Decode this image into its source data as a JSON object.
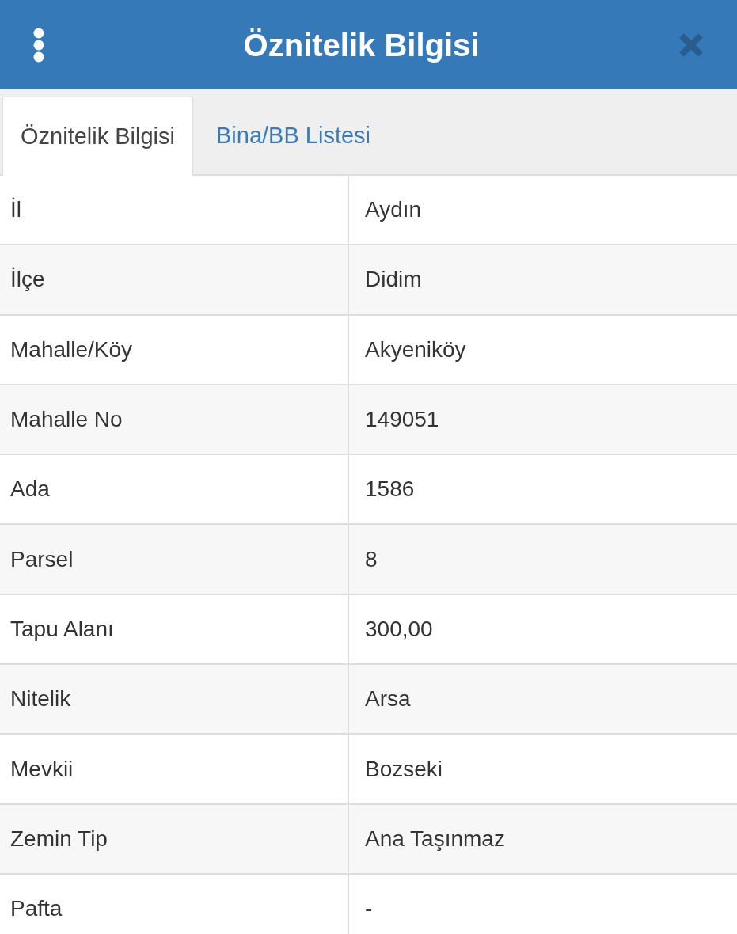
{
  "header": {
    "title": "Öznitelik Bilgisi"
  },
  "tabs": [
    {
      "label": "Öznitelik Bilgisi",
      "selected": true
    },
    {
      "label": "Bina/BB Listesi",
      "selected": false
    }
  ],
  "table": {
    "rows": [
      {
        "label": "İl",
        "value": "Aydın"
      },
      {
        "label": "İlçe",
        "value": "Didim"
      },
      {
        "label": "Mahalle/Köy",
        "value": "Akyeniköy"
      },
      {
        "label": "Mahalle No",
        "value": "149051"
      },
      {
        "label": "Ada",
        "value": "1586"
      },
      {
        "label": "Parsel",
        "value": "8"
      },
      {
        "label": "Tapu Alanı",
        "value": "300,00"
      },
      {
        "label": "Nitelik",
        "value": "Arsa"
      },
      {
        "label": "Mevkii",
        "value": "Bozseki"
      },
      {
        "label": "Zemin Tip",
        "value": "Ana Taşınmaz"
      },
      {
        "label": "Pafta",
        "value": "-"
      }
    ]
  }
}
